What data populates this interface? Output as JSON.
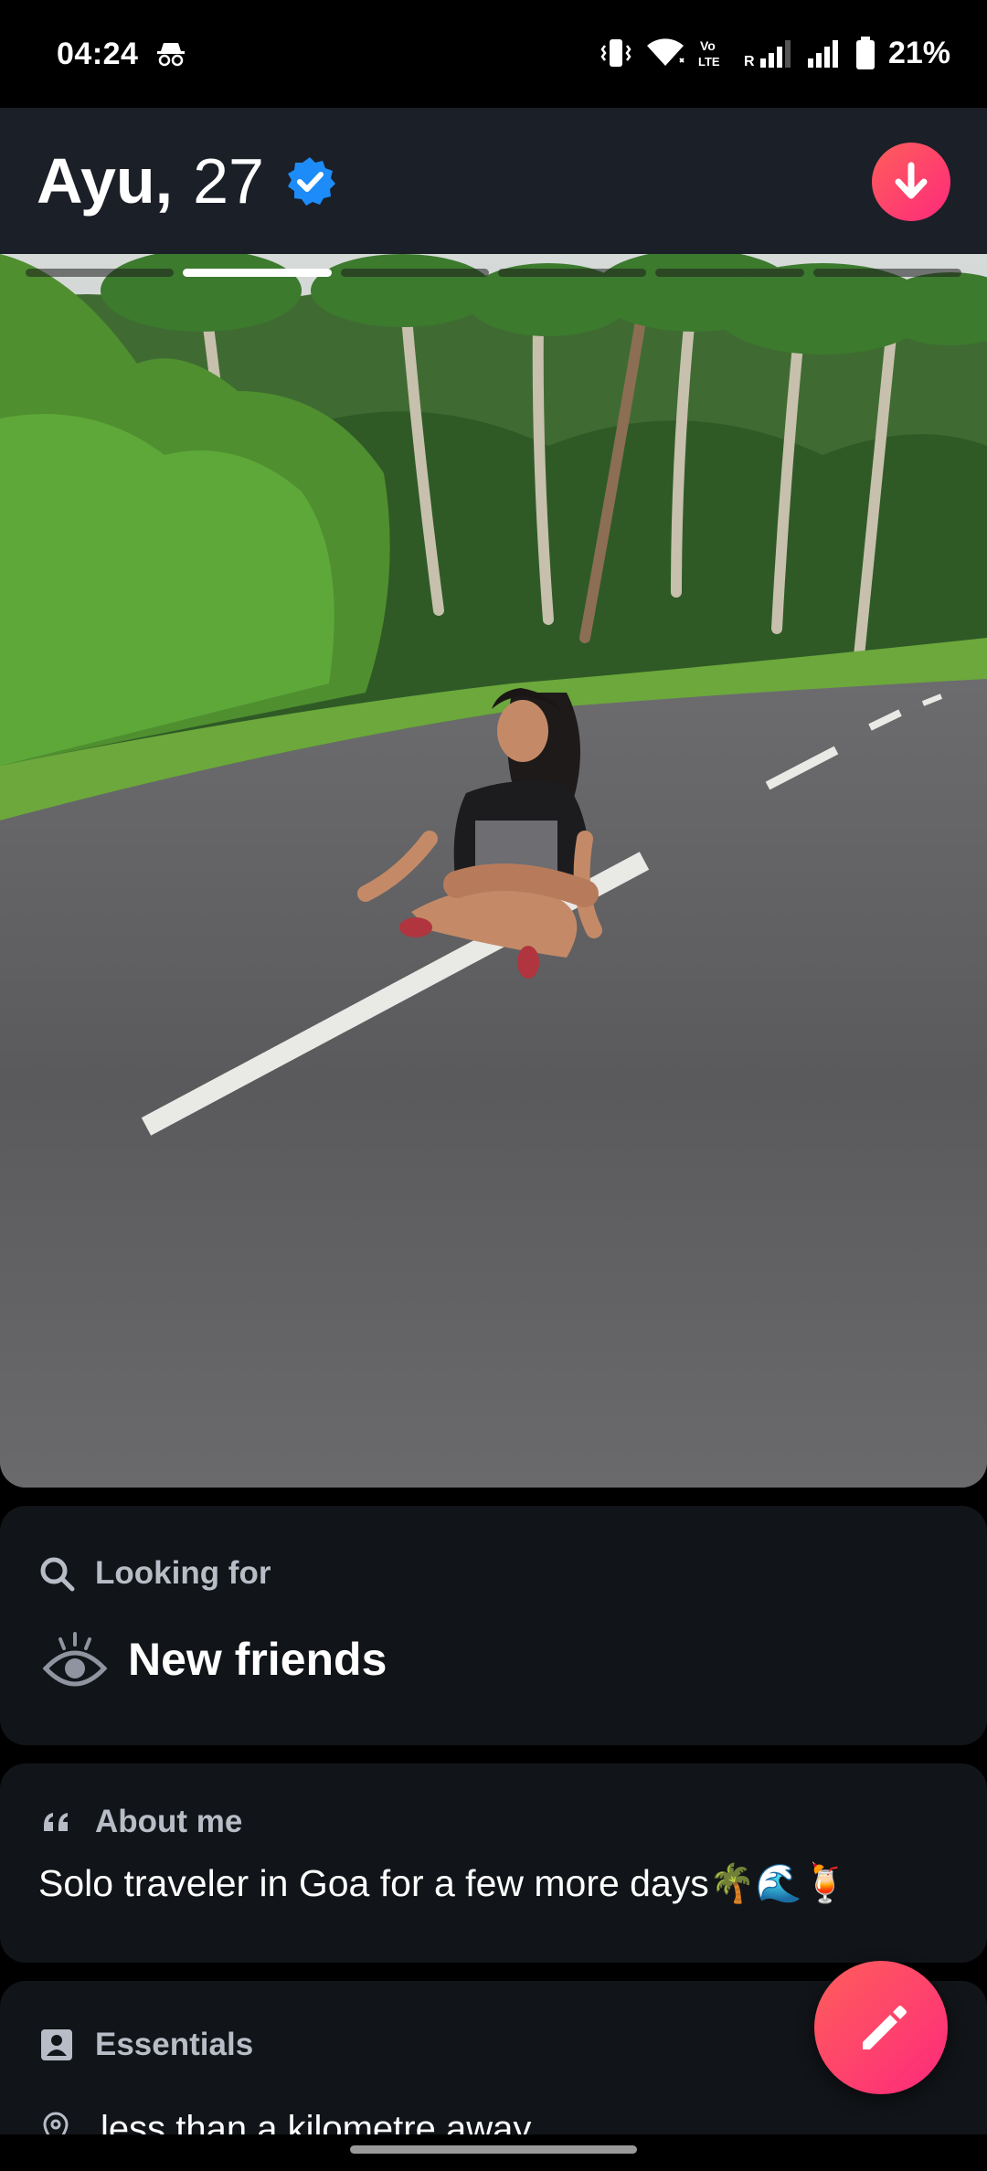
{
  "status_bar": {
    "time": "04:24",
    "battery": "21%",
    "icons": [
      "incognito-icon",
      "vibrate-icon",
      "wifi-icon",
      "volte-icon",
      "signal-icon",
      "signal-icon",
      "battery-icon"
    ],
    "volte_label": "Vo LTE",
    "roaming_label": "R"
  },
  "profile": {
    "name": "Ayu,",
    "age": "27",
    "verified": true,
    "photo_count": 6,
    "active_photo_index": 1
  },
  "looking_for": {
    "title": "Looking for",
    "value": "New friends"
  },
  "about": {
    "title": "About me",
    "text": "Solo traveler in Goa for a few more days🌴🌊🍹"
  },
  "essentials": {
    "title": "Essentials",
    "distance": "less than a kilometre away."
  },
  "colors": {
    "accent_start": "#fe5f5b",
    "accent_end": "#fd297b",
    "verified_blue": "#1d8cf8",
    "card_bg": "#111418",
    "header_bg": "#1b1f28"
  }
}
